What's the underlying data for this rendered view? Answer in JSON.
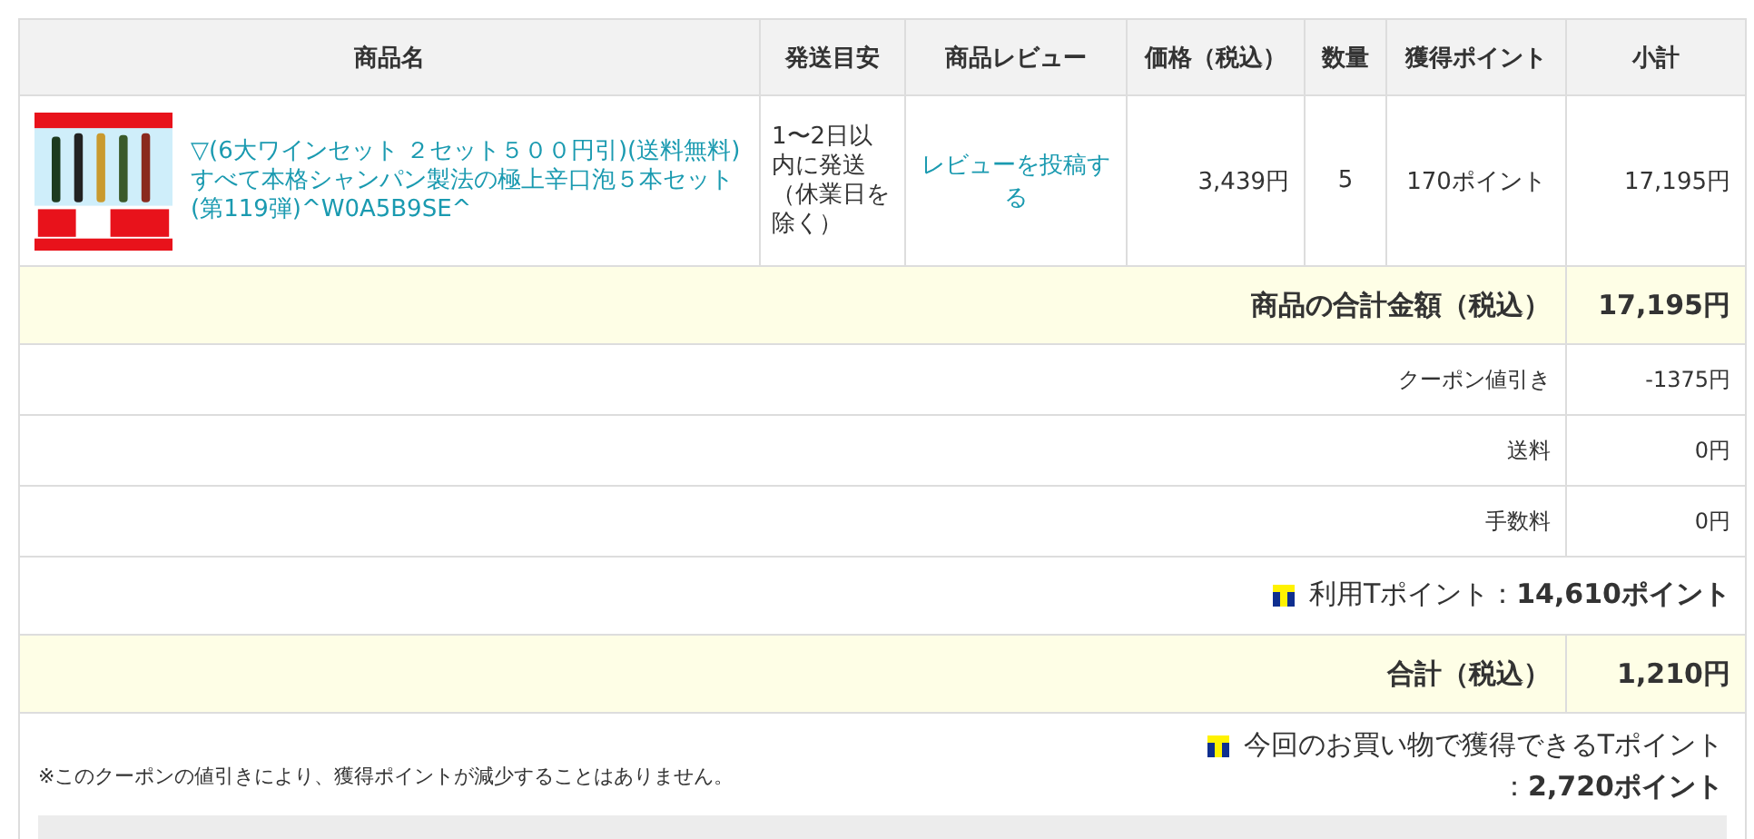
{
  "table": {
    "columns": [
      "商品名",
      "発送目安",
      "商品レビュー",
      "価格（税込）",
      "数量",
      "獲得ポイント",
      "小計"
    ],
    "items": [
      {
        "name": "▽(6大ワインセット ２セット５００円引)(送料無料)すべて本格シャンパン製法の極上辛口泡５本セット(第119弾)^W0A5B9SE^",
        "shipping": "1〜2日以内に発送（休業日を除く）",
        "review_link": "レビューを投稿する",
        "price": "3,439円",
        "quantity": "5",
        "points": "170ポイント",
        "subtotal": "17,195円"
      }
    ]
  },
  "summary": [
    {
      "kind": "highlight",
      "label": "商品の合計金額（税込）",
      "value": "17,195円"
    },
    {
      "kind": "plain",
      "label": "クーポン値引き",
      "value": "-1375円"
    },
    {
      "kind": "plain",
      "label": "送料",
      "value": "0円"
    },
    {
      "kind": "plain",
      "label": "手数料",
      "value": "0円"
    },
    {
      "kind": "tpoint",
      "text": "利用Tポイント：**14,610ポイント**"
    },
    {
      "kind": "highlight",
      "label": "合計（税込）",
      "value": "1,210円"
    }
  ],
  "note": "※このクーポンの値引きにより、獲得ポイントが減少することはありません。",
  "earned_points": {
    "label": "今回のお買い物で獲得できるTポイント",
    "value": "：**2,720ポイント**"
  }
}
